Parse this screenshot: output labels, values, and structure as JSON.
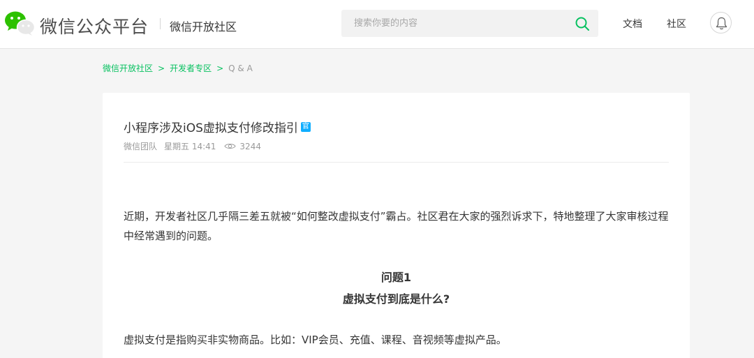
{
  "header": {
    "brand_name": "微信公众平台",
    "brand_sub": "微信开放社区",
    "search_placeholder": "搜索你要的内容",
    "nav_docs": "文档",
    "nav_community": "社区"
  },
  "breadcrumb": {
    "items": [
      "微信开放社区",
      "开发者专区"
    ],
    "separator": ">",
    "current": "Q & A"
  },
  "post": {
    "title": "小程序涉及iOS虚拟支付修改指引",
    "badge": "官",
    "author": "微信团队",
    "time": "星期五 14:41",
    "views": "3244",
    "intro": "近期，开发者社区几乎隔三差五就被“如何整改虚拟支付”霸占。社区君在大家的强烈诉求下，特地整理了大家审核过程中经常遇到的问题。",
    "question_number": "问题1",
    "question_text": "虚拟支付到底是什么?",
    "answer": "虚拟支付是指购买非实物商品。比如：VIP会员、充值、课程、音视频等虚拟产品。"
  },
  "colors": {
    "accent_green": "#07c160",
    "badge_blue": "#10aeff"
  }
}
